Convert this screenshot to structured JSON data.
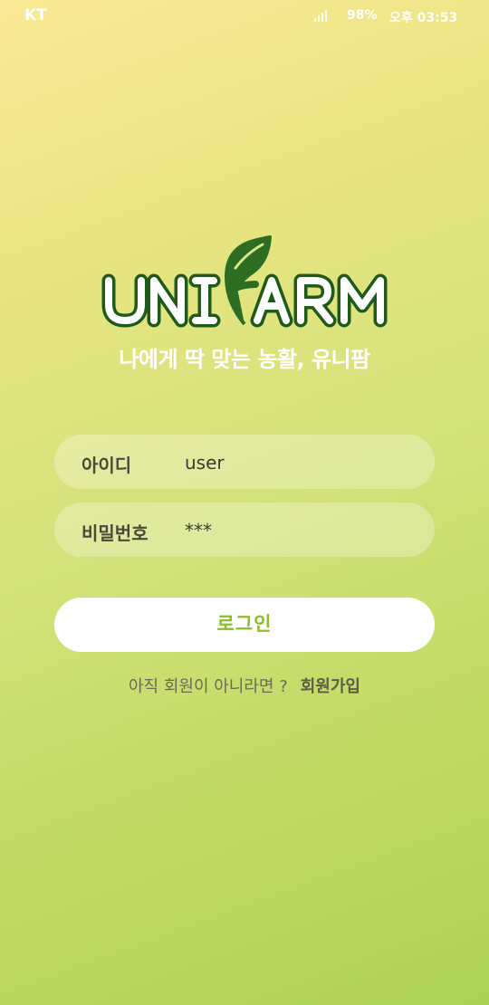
{
  "status_bar": {
    "carrier": "KT",
    "battery": "98%",
    "time": "오후 03:53",
    "signal_icon": "signal-bars-icon"
  },
  "brand": {
    "logo_text": "UNIFARM",
    "tagline": "나에게 딱 맞는 농활, 유니팜",
    "logo_colors": {
      "outline": "#1f5a1a",
      "fill": "#ffffff",
      "leaf": "#2d6e23"
    }
  },
  "login_form": {
    "id_label": "아이디",
    "id_value": "user",
    "password_label": "비밀번호",
    "password_value": "***",
    "login_button": "로그인"
  },
  "signup": {
    "prompt": "아직 회원이 아니라면 ?",
    "link": "회원가입"
  },
  "colors": {
    "accent": "#8bbe2b",
    "background_top": "#fbe996",
    "background_bottom": "#aed156"
  }
}
